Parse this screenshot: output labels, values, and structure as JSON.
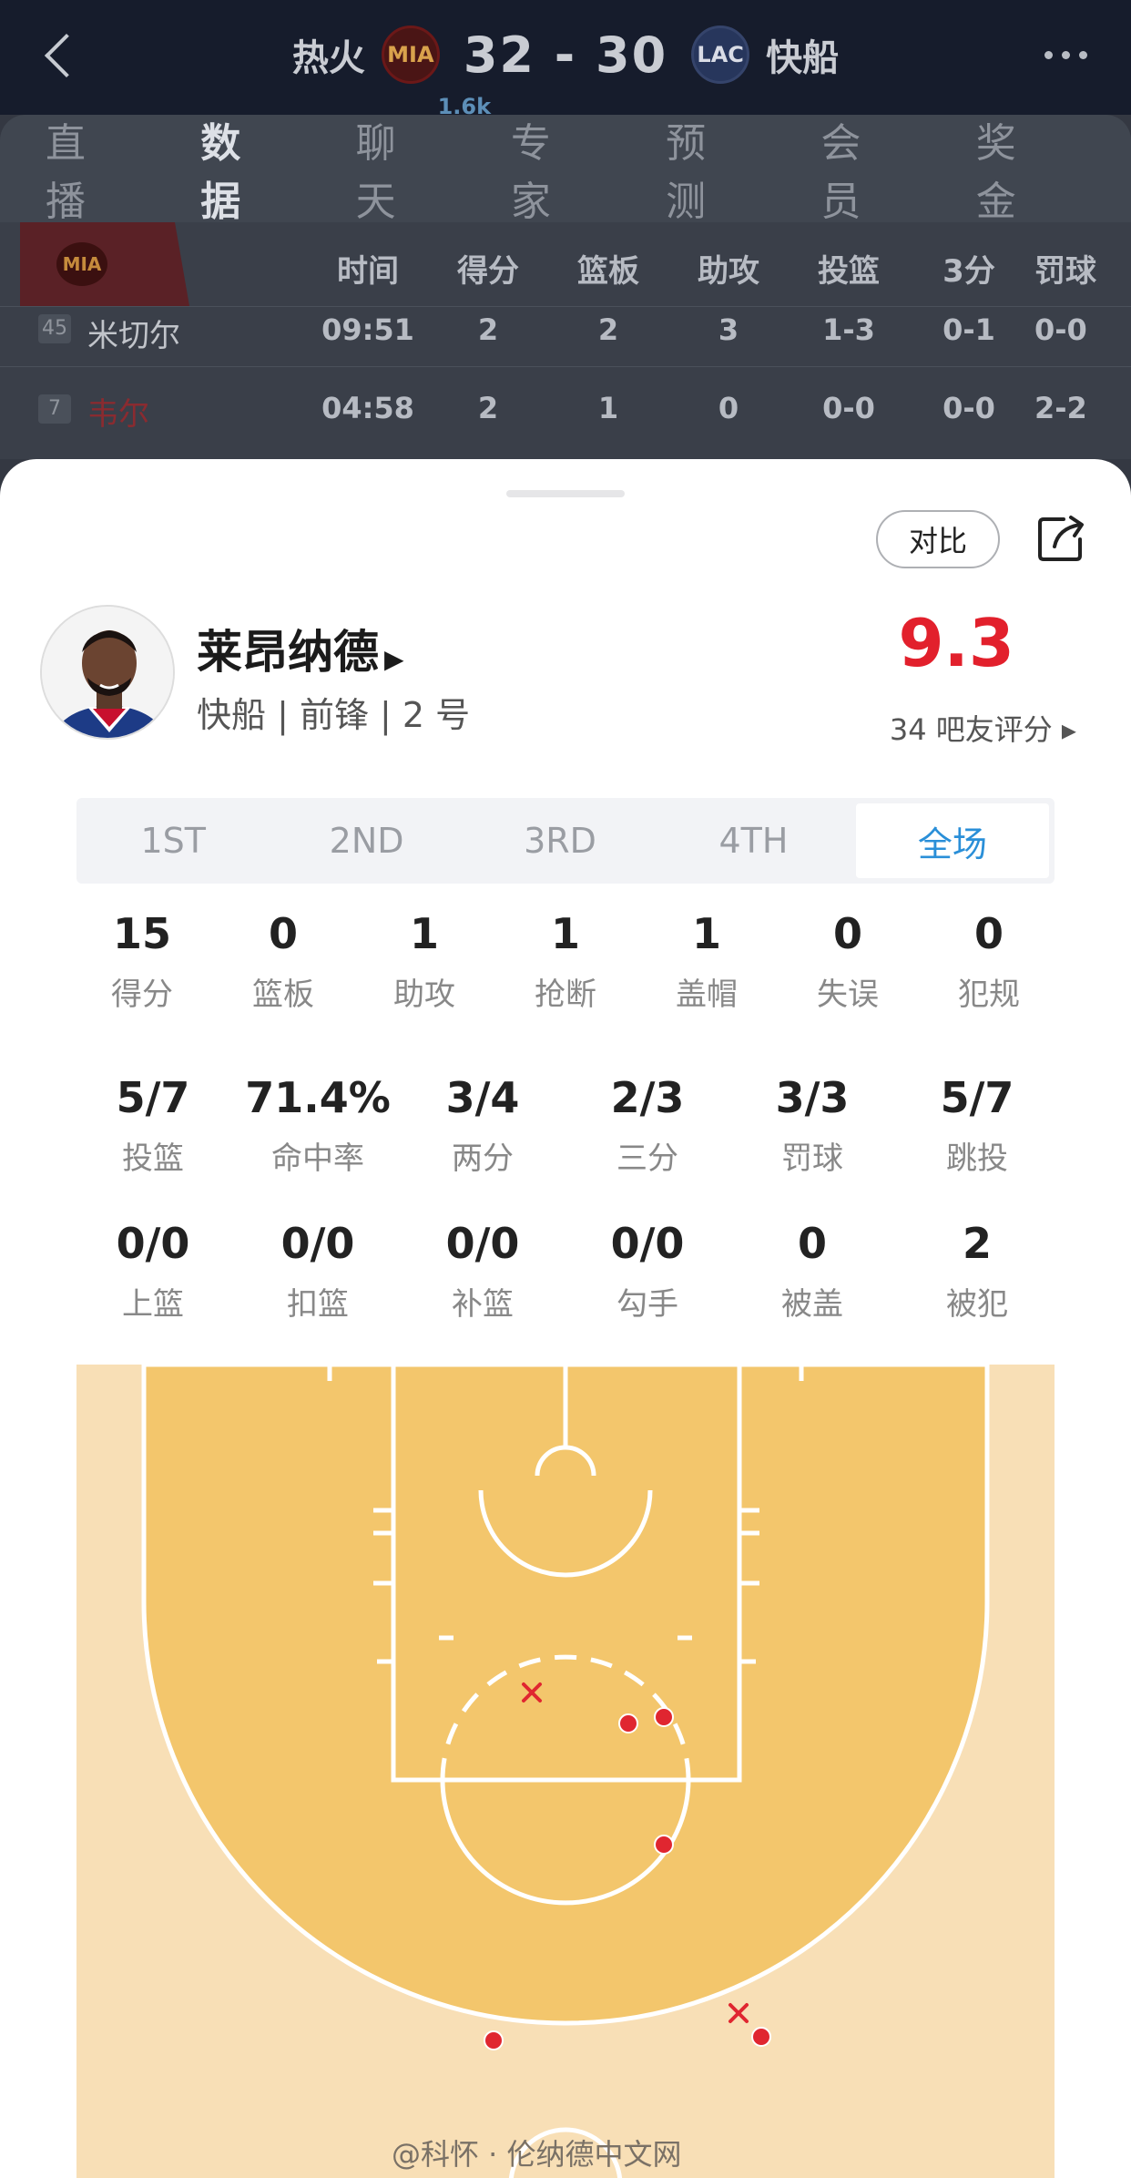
{
  "header": {
    "home_team": "热火",
    "home_abbr": "MIA",
    "score": "32 - 30",
    "away_abbr": "LAC",
    "away_team": "快船"
  },
  "tabs": [
    {
      "label": "直播"
    },
    {
      "label": "数据"
    },
    {
      "label": "聊天"
    },
    {
      "label": "专家"
    },
    {
      "label": "预测"
    },
    {
      "label": "会员"
    },
    {
      "label": "奖金"
    }
  ],
  "chat_badge": "1.6k",
  "table": {
    "team_abbr": "MIA",
    "headers": [
      "时间",
      "得分",
      "篮板",
      "助攻",
      "投篮",
      "3分",
      "罚球"
    ],
    "rows": [
      {
        "number": "45",
        "name": "米切尔",
        "cells": [
          "09:51",
          "2",
          "2",
          "3",
          "1-3",
          "0-1",
          "0-0"
        ]
      },
      {
        "number": "7",
        "name": "韦尔",
        "cells": [
          "04:58",
          "2",
          "1",
          "0",
          "0-0",
          "0-0",
          "2-2"
        ]
      }
    ]
  },
  "player": {
    "compare_label": "对比",
    "name": "莱昂纳德",
    "meta": "快船 | 前锋 | 2 号",
    "rating": "9.3",
    "rating_sub": "34 吧友评分 ▸"
  },
  "quarter_tabs": [
    "1ST",
    "2ND",
    "3RD",
    "4TH",
    "全场"
  ],
  "stats_row1": [
    {
      "value": "15",
      "label": "得分"
    },
    {
      "value": "0",
      "label": "篮板"
    },
    {
      "value": "1",
      "label": "助攻"
    },
    {
      "value": "1",
      "label": "抢断"
    },
    {
      "value": "1",
      "label": "盖帽"
    },
    {
      "value": "0",
      "label": "失误"
    },
    {
      "value": "0",
      "label": "犯规"
    }
  ],
  "stats_row2": [
    {
      "value": "5/7",
      "label": "投篮"
    },
    {
      "value": "71.4%",
      "label": "命中率"
    },
    {
      "value": "3/4",
      "label": "两分"
    },
    {
      "value": "2/3",
      "label": "三分"
    },
    {
      "value": "3/3",
      "label": "罚球"
    },
    {
      "value": "5/7",
      "label": "跳投"
    }
  ],
  "stats_row3": [
    {
      "value": "0/0",
      "label": "上篮"
    },
    {
      "value": "0/0",
      "label": "扣篮"
    },
    {
      "value": "0/0",
      "label": "补篮"
    },
    {
      "value": "0/0",
      "label": "勾手"
    },
    {
      "value": "0",
      "label": "被盖"
    },
    {
      "value": "2",
      "label": "被犯"
    }
  ],
  "shot_chart": {
    "made_color": "#e02630",
    "missed_color": "#e02630",
    "made_count": 5,
    "missed_count": 2
  },
  "watermark": "@科怀 · 伦纳德中文网",
  "colors": {
    "accent_blue": "#2a8fd8",
    "rating_red": "#e2202c",
    "court_paint": "#f3c66c",
    "court_outer": "#f8dfb6"
  }
}
